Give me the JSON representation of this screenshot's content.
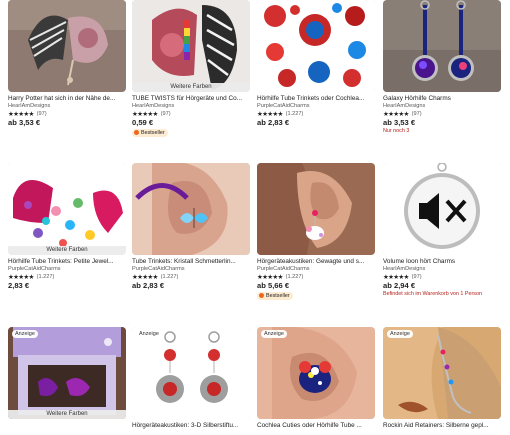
{
  "listings": [
    {
      "title": "Harry Potter hat sich in der Nähe de...",
      "shop": "HearIAmDesigns",
      "stars": "★★★★★",
      "rating_count": "(97)",
      "price": "ab 3,53 €"
    },
    {
      "title": "TUBE TWISTS für Hörgeräte und Co...",
      "shop": "HearIAmDesigns",
      "stars": "★★★★★",
      "rating_count": "(97)",
      "price": "0,59 €",
      "overlay": "Weitere Farben",
      "badge": "Bestseller"
    },
    {
      "title": "Hörhilfe Tube Trinkets oder Cochlea...",
      "shop": "PurpleCatAidCharms",
      "stars": "★★★★★",
      "rating_count": "(1.227)",
      "price": "ab 2,83 €"
    },
    {
      "title": "Galaxy Hörhilfe Charms",
      "shop": "HearIAmDesigns",
      "stars": "★★★★★",
      "rating_count": "(97)",
      "price": "ab 3,53 €",
      "note": "Nur noch 3"
    },
    {
      "title": "Hörhilfe Tube Trinkets: Petite Jewel...",
      "shop": "PurpleCatAidCharms",
      "stars": "★★★★★",
      "rating_count": "(1.227)",
      "price": "2,83 €",
      "overlay": "Weitere Farben"
    },
    {
      "title": "Tube Trinkets: Kristall Schmetterlin...",
      "shop": "PurpleCatAidCharms",
      "stars": "★★★★★",
      "rating_count": "(1.227)",
      "price": "ab 2,83 €"
    },
    {
      "title": "Hörgeräteakustiken: Gewagte und s...",
      "shop": "PurpleCatAidCharms",
      "stars": "★★★★★",
      "rating_count": "(1.227)",
      "price": "ab 5,66 €",
      "badge": "Bestseller"
    },
    {
      "title": "Volume loon hört Charms",
      "shop": "HearIAmDesigns",
      "stars": "★★★★★",
      "rating_count": "(97)",
      "price": "ab 2,94 €",
      "note": "Befindet sich im Warenkorb von 1 Person"
    },
    {
      "title": "",
      "overlay": "Weitere Farben",
      "ad": "Anzeige"
    },
    {
      "title": "Hörgeräteakustiken: 3-D Silberstiftu...",
      "ad": "Anzeige"
    },
    {
      "title": "Cochlea Cuties oder Hörhilfe Tube ...",
      "ad": "Anzeige"
    },
    {
      "title": "Rockin Aid Retainers: Silberne gepl...",
      "ad": "Anzeige"
    }
  ],
  "colors": {
    "star": "#222222",
    "warning": "#b3261e",
    "bestseller_bg": "#fdebd2",
    "bestseller_icon": "#f1641e"
  },
  "icons": {
    "bestseller": "ribbon-icon"
  }
}
